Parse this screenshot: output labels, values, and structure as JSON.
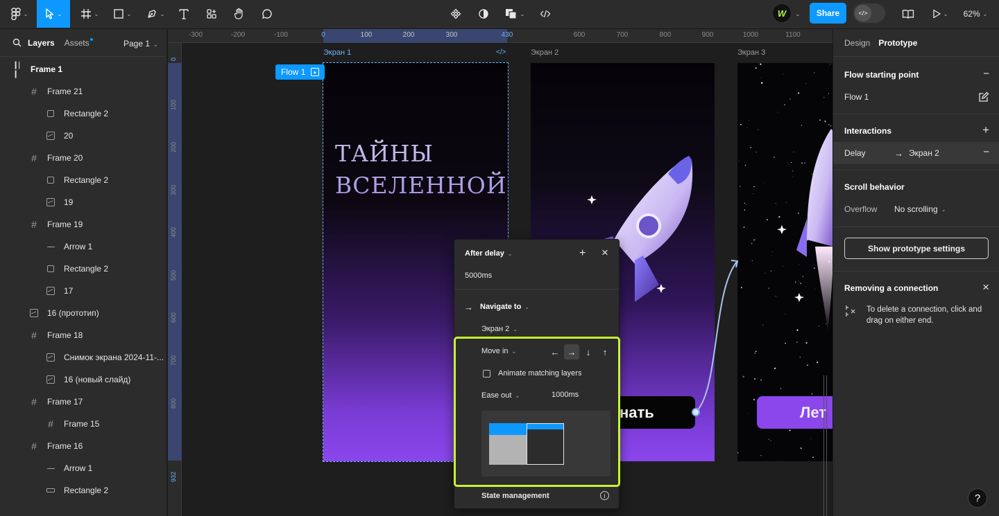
{
  "toolbar": {
    "center_icons": [
      "components-icon",
      "contrast-icon",
      "boolean-icon",
      "code-icon"
    ],
    "share_label": "Share",
    "zoom_label": "62%",
    "avatar_initials": "W"
  },
  "left_panel": {
    "tabs": [
      "Layers",
      "Assets"
    ],
    "page_label": "Page 1",
    "layers": [
      {
        "label": "Frame 1",
        "icon": "flow-frame-icon",
        "indent": 0,
        "bold": true
      },
      {
        "label": "Frame 21",
        "icon": "frame-icon",
        "indent": 1
      },
      {
        "label": "Rectangle 2",
        "icon": "rectangle-icon",
        "indent": 2
      },
      {
        "label": "20",
        "icon": "image-icon",
        "indent": 2
      },
      {
        "label": "Frame 20",
        "icon": "frame-icon",
        "indent": 1
      },
      {
        "label": "Rectangle 2",
        "icon": "rectangle-icon",
        "indent": 2
      },
      {
        "label": "19",
        "icon": "image-icon",
        "indent": 2
      },
      {
        "label": "Frame 19",
        "icon": "frame-icon",
        "indent": 1
      },
      {
        "label": "Arrow 1",
        "icon": "line-icon",
        "indent": 2
      },
      {
        "label": "Rectangle 2",
        "icon": "rectangle-icon",
        "indent": 2
      },
      {
        "label": "17",
        "icon": "image-icon",
        "indent": 2
      },
      {
        "label": "16 (прототип)",
        "icon": "image-icon",
        "indent": 1
      },
      {
        "label": "Frame 18",
        "icon": "frame-icon",
        "indent": 1
      },
      {
        "label": "Снимок экрана 2024-11-...",
        "icon": "image-icon",
        "indent": 2
      },
      {
        "label": "16 (новый слайд)",
        "icon": "image-icon",
        "indent": 2
      },
      {
        "label": "Frame 17",
        "icon": "frame-icon",
        "indent": 1
      },
      {
        "label": "Frame 15",
        "icon": "frame-icon",
        "indent": 2
      },
      {
        "label": "Frame 16",
        "icon": "frame-icon",
        "indent": 1
      },
      {
        "label": "Arrow 1",
        "icon": "line-icon",
        "indent": 2
      },
      {
        "label": "Rectangle 2",
        "icon": "wide-rectangle-icon",
        "indent": 2
      }
    ]
  },
  "rulers": {
    "top": [
      "-300",
      "-200",
      "-100",
      "0",
      "100",
      "200",
      "300",
      "430",
      "600",
      "700",
      "800",
      "900",
      "1000",
      "1100"
    ],
    "left": [
      "0",
      "100",
      "200",
      "300",
      "400",
      "500",
      "600",
      "700",
      "800",
      "932",
      "93:"
    ]
  },
  "canvas": {
    "frames": [
      "Экран 1",
      "Экран 2",
      "Экран 3"
    ],
    "flow_tag": "Flow 1",
    "screen1_title_line1": "ТАЙНЫ",
    "screen1_title_line2": "ВСЕЛЕННОЙ",
    "screen2_button": "нать",
    "screen3_button": "Лет"
  },
  "interaction_popup": {
    "trigger": "After delay",
    "delay_value": "5000ms",
    "action": "Navigate to",
    "destination": "Экран 2",
    "animation": "Move in",
    "directions": [
      "←",
      "→",
      "↓",
      "↑"
    ],
    "selected_direction": "→",
    "animate_matching_label": "Animate matching layers",
    "animate_matching_checked": false,
    "easing": "Ease out",
    "duration": "1000ms",
    "state_management": "State management"
  },
  "right_panel": {
    "tabs": [
      "Design",
      "Prototype"
    ],
    "active_tab": "Prototype",
    "flow_starting_point_title": "Flow starting point",
    "flow_name": "Flow 1",
    "interactions_title": "Interactions",
    "interaction_trigger": "Delay",
    "interaction_target": "Экран 2",
    "scroll_behavior_title": "Scroll behavior",
    "overflow_label": "Overflow",
    "overflow_value": "No scrolling",
    "prototype_settings_button": "Show prototype settings",
    "removing_title": "Removing a connection",
    "removing_text": "To delete a connection, click and drag on either end."
  },
  "colors": {
    "accent": "#0d99ff",
    "highlight": "#c6f432",
    "panel_bg": "#2c2c2c",
    "canvas_bg": "#1e1e1e"
  }
}
